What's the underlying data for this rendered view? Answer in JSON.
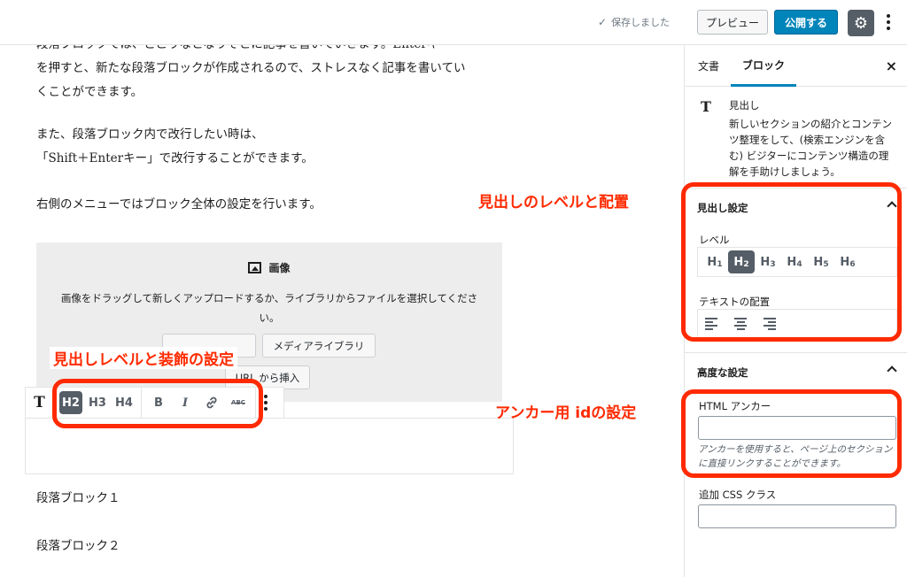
{
  "topbar": {
    "saved_text": "保存しました",
    "preview_label": "プレビュー",
    "publish_label": "公開する"
  },
  "editor": {
    "paragraphs": [
      "段落ブロックでは、どこりなとなりそとに記事を書いていきます。Enterキ",
      "を押すと、新たな段落ブロックが作成されるので、ストレスなく記事を書いてい",
      "くことができます。",
      "また、段落ブロック内で改行したい時は、",
      "「Shift＋Enterキー」で改行することができます。",
      "右側のメニューではブロック全体の設定を行います。"
    ],
    "image_block": {
      "title": "画像",
      "description": "画像をドラッグして新しくアップロードするか、ライブラリからファイルを選択してください。",
      "media_library_label": "メディアライブラリ",
      "url_insert_label": "URL から挿入"
    },
    "toolbar": {
      "transform_label": "T",
      "h2": "H2",
      "h3": "H3",
      "h4": "H4",
      "bold": "B",
      "italic": "I",
      "strikethrough": "ABC"
    },
    "after_paragraphs": [
      "段落ブロック１",
      "段落ブロック２"
    ]
  },
  "annotations": {
    "heading_level_align": "見出しのレベルと配置",
    "heading_level_decoration": "見出しレベルと装飾の設定",
    "anchor_id": "アンカー用 idの設定"
  },
  "sidebar": {
    "tab_document": "文書",
    "tab_block": "ブロック",
    "close": "×",
    "block_icon": "T",
    "block_name": "見出し",
    "block_description": "新しいセクションの紹介とコンテンツ整理をして、(検索エンジンを含む) ビジターにコンテンツ構造の理解を手助けしましょう。",
    "heading_settings": {
      "title": "見出し設定",
      "level_label": "レベル",
      "levels": [
        {
          "h": "H",
          "n": "1"
        },
        {
          "h": "H",
          "n": "2"
        },
        {
          "h": "H",
          "n": "3"
        },
        {
          "h": "H",
          "n": "4"
        },
        {
          "h": "H",
          "n": "5"
        },
        {
          "h": "H",
          "n": "6"
        }
      ],
      "selected_level": "2",
      "alignment_label": "テキストの配置"
    },
    "advanced": {
      "title": "高度な設定",
      "anchor_label": "HTML アンカー",
      "anchor_value": "",
      "anchor_help": "アンカーを使用すると、ページ上のセクションに直接リンクすることができます。",
      "css_label": "追加 CSS クラス",
      "css_value": ""
    }
  },
  "colors": {
    "accent": "#0085ba",
    "annotation": "#ff2a00",
    "active_button": "#555d66"
  }
}
